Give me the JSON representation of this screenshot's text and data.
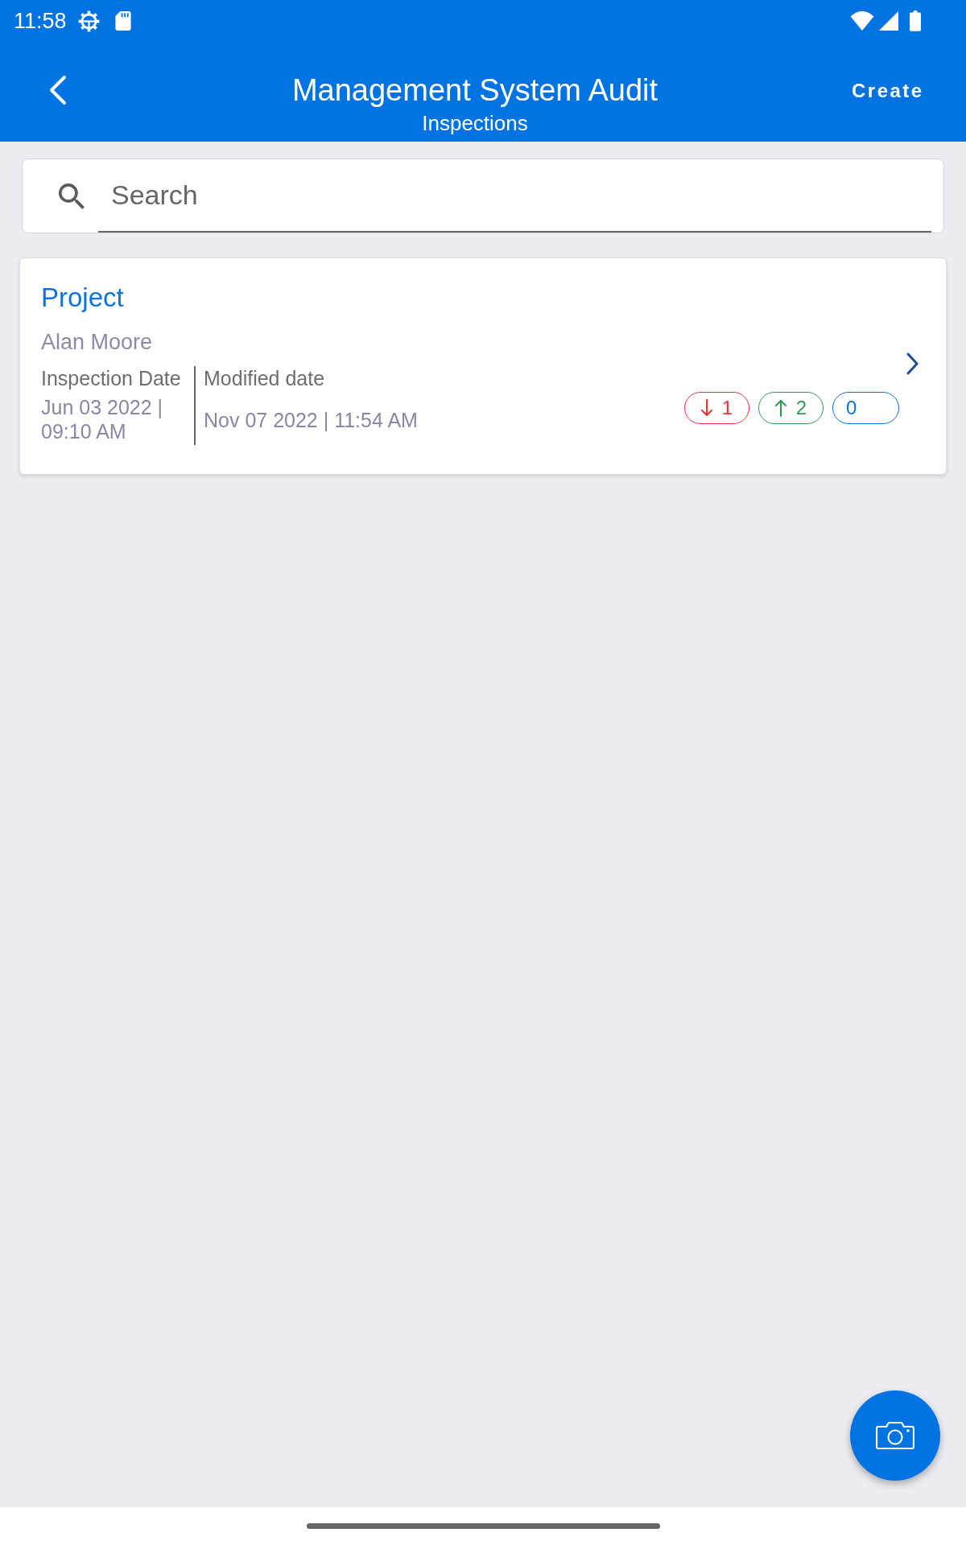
{
  "status_bar": {
    "time": "11:58"
  },
  "header": {
    "title": "Management System Audit",
    "subtitle": "Inspections",
    "action": "Create"
  },
  "search": {
    "placeholder": "Search"
  },
  "inspections": [
    {
      "title": "Project",
      "inspector": "Alan Moore",
      "dates": [
        {
          "label": "Inspection Date",
          "value": "Jun 03 2022 | 09:10 AM"
        },
        {
          "label": "Modified date",
          "value": "Nov 07 2022 | 11:54 AM"
        }
      ],
      "counters": [
        {
          "kind": "down",
          "value": "1",
          "color": "#e8353b"
        },
        {
          "kind": "up",
          "value": "2",
          "color": "#2f9b52"
        },
        {
          "kind": "plain",
          "value": "0",
          "color": "#0a73e0"
        }
      ]
    }
  ]
}
